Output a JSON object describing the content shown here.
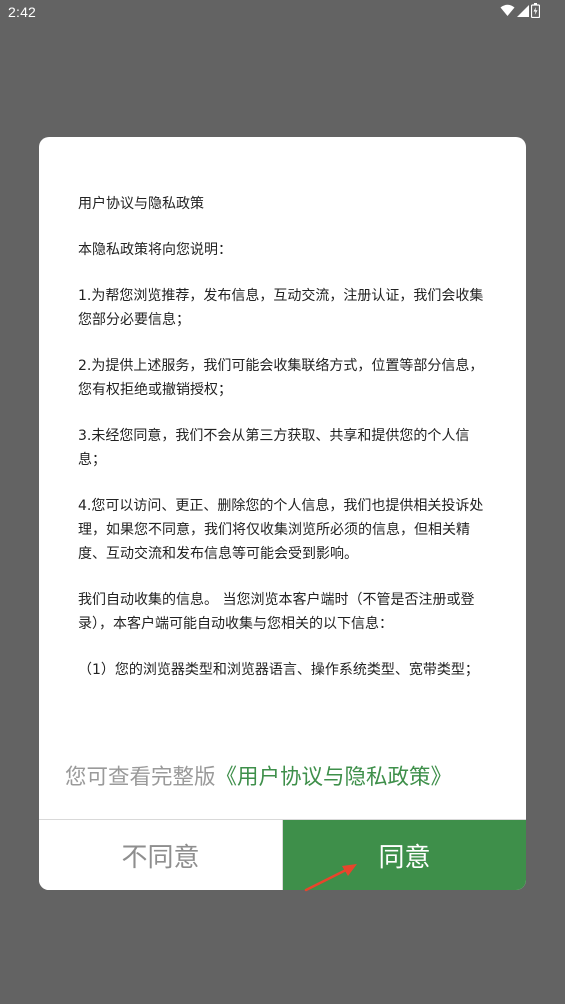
{
  "status_bar": {
    "time": "2:42",
    "icons": [
      "wifi-icon",
      "signal-icon",
      "battery-icon"
    ]
  },
  "dialog": {
    "paragraphs": [
      "用户协议与隐私政策",
      "本隐私政策将向您说明：",
      "1.为帮您浏览推荐，发布信息，互动交流，注册认证，我们会收集您部分必要信息；",
      "2.为提供上述服务，我们可能会收集联络方式，位置等部分信息，您有权拒绝或撤销授权；",
      "3.未经您同意，我们不会从第三方获取、共享和提供您的个人信息；",
      "4.您可以访问、更正、删除您的个人信息，我们也提供相关投诉处理，如果您不同意，我们将仅收集浏览所必须的信息，但相关精度、互动交流和发布信息等可能会受到影响。",
      "我们自动收集的信息。 当您浏览本客户端时（不管是否注册或登录），本客户端可能自动收集与您相关的以下信息：",
      "（1）您的浏览器类型和浏览器语言、操作系统类型、宽带类型；"
    ],
    "more_prefix": "您可查看完整版",
    "more_link": "《用户协议与隐私政策》",
    "disagree_label": "不同意",
    "agree_label": "同意"
  },
  "colors": {
    "accent_green": "#3e8f4a",
    "overlay": "#636363",
    "annotation_arrow": "#e8452c"
  }
}
